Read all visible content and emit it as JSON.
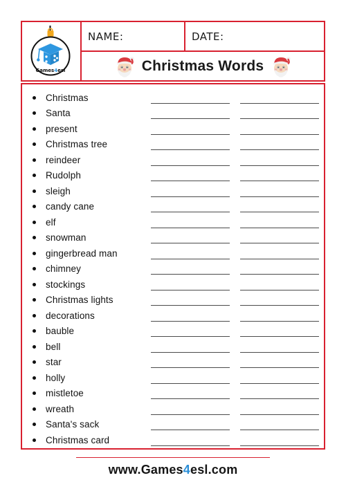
{
  "colors": {
    "border_red": "#d8202f",
    "text_dark": "#121212",
    "line_gray": "#4a4a4a",
    "accent_blue": "#2b8fd8",
    "santa_hat_red": "#d93a3f",
    "logo_blue": "#2e97e0"
  },
  "header": {
    "logo_alt": "Games4esl",
    "logo_text": "Games4esl",
    "name_label": "NAME:",
    "date_label": "DATE:",
    "title": "Christmas Words",
    "left_icon": "santa-face-icon",
    "right_icon": "santa-face-icon",
    "logo_icon": "christmas-ornament-graduation-cap-icon"
  },
  "worksheet": {
    "words": [
      "Christmas",
      "Santa",
      "present",
      "Christmas tree",
      "reindeer",
      "Rudolph",
      "sleigh",
      "candy cane",
      "elf",
      "snowman",
      "gingerbread man",
      "chimney",
      "stockings",
      "Christmas lights",
      "decorations",
      "bauble",
      "bell",
      "star",
      "holly",
      "mistletoe",
      "wreath",
      "Santa's sack",
      "Christmas card"
    ],
    "answer_columns": 2,
    "answer_values": [
      "",
      ""
    ]
  },
  "footer": {
    "url_prefix": "www.Games",
    "url_accent": "4",
    "url_suffix": "esl.com"
  }
}
